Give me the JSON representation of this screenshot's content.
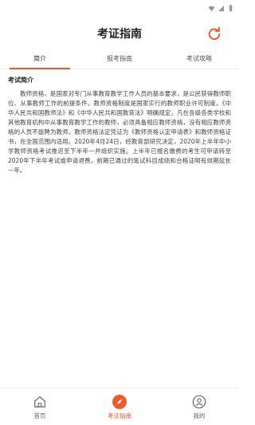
{
  "header": {
    "title": "考证指南"
  },
  "tabs": [
    {
      "label": "简介",
      "active": true
    },
    {
      "label": "报考指南",
      "active": false
    },
    {
      "label": "考试攻略",
      "active": false
    }
  ],
  "content": {
    "section_title": "考试简介",
    "body": "教师资格，是国家对专门从事教育教学工作人员的基本要求，是公民获得教师职位、从事教师工作的前提条件。教师资格制度是国家实行的教师职业许可制度。《中华人民共和国教师法》和《中华人民共和国教育法》明确规定，凡在各级各类学校和其他教育机构中从事教育教学工作的教师，必须具备相应教师资格，没有相应教师资格的人员不能聘为教师。教师资格法定凭证为《教师资格认定申请表》和教师资格证书，在全国范围内适用。2020年4月24日，经教育部研究决定，2020年上半年中小学教师资格考试推迟至下半年一并组织实施。上半年已报名缴费的考生可申请转至2020年下半年考试或申请退费，前期已通过的笔试科目成绩和合格证明有效期延长一年。"
  },
  "bottom_nav": [
    {
      "label": "首页",
      "icon": "home-icon",
      "active": false
    },
    {
      "label": "考证指南",
      "icon": "compass-icon",
      "active": true
    },
    {
      "label": "我的",
      "icon": "user-icon",
      "active": false
    }
  ],
  "colors": {
    "accent": "#f05a28"
  },
  "status_icons": [
    "wifi-icon",
    "signal-icon",
    "battery-icon"
  ]
}
